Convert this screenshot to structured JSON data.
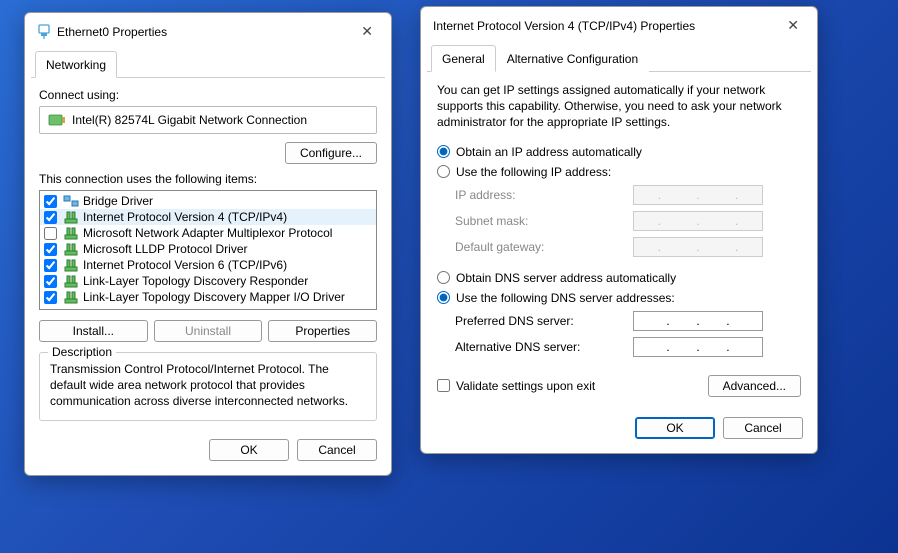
{
  "win1": {
    "title": "Ethernet0 Properties",
    "tab_networking": "Networking",
    "connect_using": "Connect using:",
    "adapter": "Intel(R) 82574L Gigabit Network Connection",
    "configure": "Configure...",
    "items_label": "This connection uses the following items:",
    "items": [
      {
        "label": "Bridge Driver",
        "checked": true
      },
      {
        "label": "Internet Protocol Version 4 (TCP/IPv4)",
        "checked": true
      },
      {
        "label": "Microsoft Network Adapter Multiplexor Protocol",
        "checked": false
      },
      {
        "label": "Microsoft LLDP Protocol Driver",
        "checked": true
      },
      {
        "label": "Internet Protocol Version 6 (TCP/IPv6)",
        "checked": true
      },
      {
        "label": "Link-Layer Topology Discovery Responder",
        "checked": true
      },
      {
        "label": "Link-Layer Topology Discovery Mapper I/O Driver",
        "checked": true
      }
    ],
    "install": "Install...",
    "uninstall": "Uninstall",
    "properties": "Properties",
    "desc_legend": "Description",
    "desc_text": "Transmission Control Protocol/Internet Protocol. The default wide area network protocol that provides communication across diverse interconnected networks.",
    "ok": "OK",
    "cancel": "Cancel"
  },
  "win2": {
    "title": "Internet Protocol Version 4 (TCP/IPv4) Properties",
    "tab_general": "General",
    "tab_alt": "Alternative Configuration",
    "intro": "You can get IP settings assigned automatically if your network supports this capability. Otherwise, you need to ask your network administrator for the appropriate IP settings.",
    "ip_auto": "Obtain an IP address automatically",
    "ip_manual": "Use the following IP address:",
    "ip_address": "IP address:",
    "subnet": "Subnet mask:",
    "gateway": "Default gateway:",
    "dns_auto": "Obtain DNS server address automatically",
    "dns_manual": "Use the following DNS server addresses:",
    "pref_dns": "Preferred DNS server:",
    "alt_dns": "Alternative DNS server:",
    "validate": "Validate settings upon exit",
    "advanced": "Advanced...",
    "ok": "OK",
    "cancel": "Cancel"
  }
}
